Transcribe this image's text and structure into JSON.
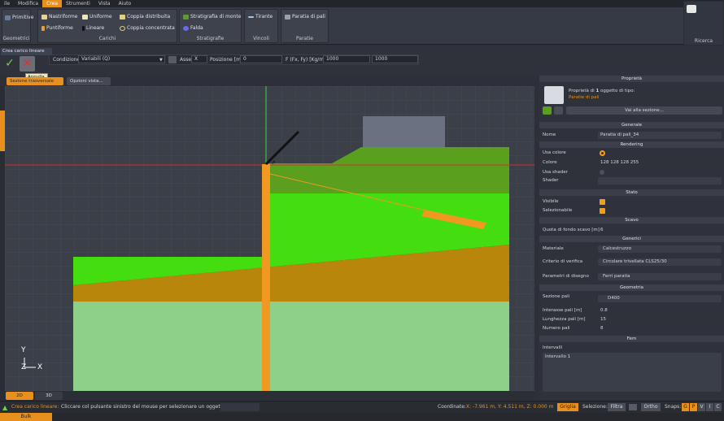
{
  "menubar": [
    "ile",
    "Modifica",
    "Crea",
    "Strumenti",
    "Vista",
    "Aiuto"
  ],
  "ribbon": {
    "geometrici": {
      "label": "Geometrici",
      "primitive": "Primitive"
    },
    "carichi": {
      "label": "Carichi",
      "items": [
        "Nastriforme",
        "Uniforme",
        "Coppia distribuita",
        "Puntiforme",
        "Lineare",
        "Coppia concentrata"
      ]
    },
    "stratigrafie": {
      "label": "Stratigrafie",
      "items": [
        "Stratigrafia di monte",
        "Falda"
      ]
    },
    "vincoli": {
      "label": "Vincoli",
      "items": [
        "Tirante"
      ]
    },
    "paratie": {
      "label": "Paratie",
      "items": [
        "Paratia di pali"
      ]
    },
    "ricerca": {
      "label": "Ricerca"
    }
  },
  "toolbar": {
    "panel_title": "Crea carico lineare",
    "tooltip": "Annulla",
    "condizione_label": "Condizione",
    "condizione_value": "Variabili (Q)",
    "asse_label": "Asse",
    "asse_value": "X",
    "posizione_label": "Posizione [m]",
    "posizione_value": "0",
    "forza_label": "F (Fx, Fy) [Kg/m]",
    "fx_value": "1000",
    "fy_value": "1000"
  },
  "viewtabs": {
    "sezione": "Sezione",
    "sezione_tail": "trasversale",
    "opzioni": "Opzioni vista..."
  },
  "bottomtabs": [
    "2D",
    "3D"
  ],
  "axes": {
    "y": "Y",
    "z": "Z",
    "x": "X"
  },
  "status": {
    "title": "Crea carico lineare:",
    "message": "Cliccare col pulsante sinistro del mouse per selezionare un oggetto",
    "coords_label": "Coordinate:",
    "coords_value": "X: -7.961 m, Y: 4.511 m, Z: 0.000 m",
    "griglia": "Griglia",
    "selezione_label": "Selezione:",
    "filtra": "Filtra",
    "ortho": "Ortho",
    "snaps_label": "Snaps:",
    "snaps": [
      "G",
      "P",
      "V",
      "I",
      "C"
    ],
    "bulk": "Bulk"
  },
  "props": {
    "title": "Proprietà",
    "subtitle_pre": "Proprietà di",
    "subtitle_count": "1",
    "subtitle_post": "oggetto di tipo:",
    "type": "Paratie di pali",
    "goto": "Vai alla sezione...",
    "generale": "Generale",
    "nome_label": "Nome",
    "nome_value": "Paratia di pali_34",
    "rendering": "Rendering",
    "usa_colore": "Usa colore",
    "colore_label": "Colore",
    "colore_value": "128 128 128 255",
    "usa_shader": "Usa shader",
    "shader": "Shader",
    "stato": "Stato",
    "visibile": "Visibile",
    "selezionabile": "Selezionabile",
    "scavo": "Scavo",
    "quota_label": "Quota di fondo scavo [m]",
    "quota_value": "6",
    "generici": "Generici",
    "materiale_label": "Materiale",
    "materiale_value": "Calcestruzzo",
    "criterio_label": "Criterio di verifica",
    "criterio_value": "Circolare trivellata CLS25/30",
    "parametri_label": "Parametri di disegno",
    "parametri_value": "Ferri paratia",
    "geometria": "Geometria",
    "sezione_label": "Sezione pali",
    "sezione_value": "D400",
    "interasse_label": "Interasse pali [m]",
    "interasse_value": "0.8",
    "lunghezza_label": "Lunghezza pali [m]",
    "lunghezza_value": "15",
    "numero_label": "Numero pali",
    "numero_value": "8",
    "fem": "Fem",
    "intervalli_label": "Intervalli",
    "intervallo_value": "Intervallo 1"
  },
  "colors": {
    "accent": "#e8901e",
    "soil_top": "#5aa01e",
    "soil_bright": "#44dd10",
    "soil_brown": "#b8860b",
    "soil_light": "#8ed089",
    "pile": "#f09820"
  }
}
